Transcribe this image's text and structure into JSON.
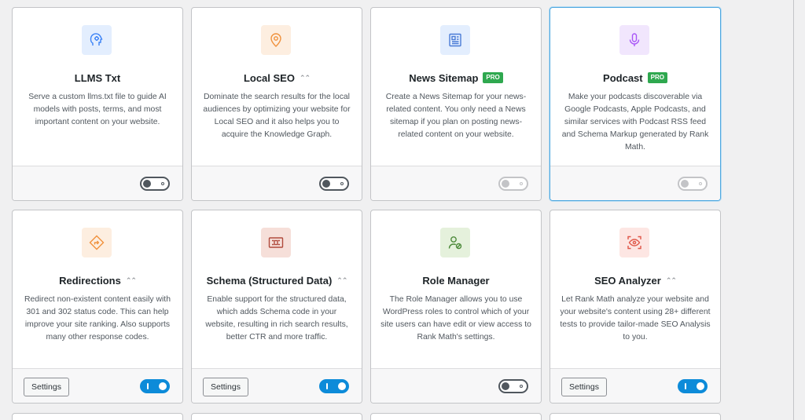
{
  "modules": [
    {
      "title": "LLMS Txt",
      "pro_badge": "",
      "has_chevron": false,
      "description": "Serve a custom llms.txt file to guide AI models with posts, terms, and most important content on your website.",
      "toggle_state": "off",
      "has_settings": false,
      "icon": "brain-head-icon",
      "icon_color": "#3b82f6",
      "icon_bg": "#e3eefe"
    },
    {
      "title": "Local SEO",
      "pro_badge": "",
      "has_chevron": true,
      "description": "Dominate the search results for the local audiences by optimizing your website for Local SEO and it also helps you to acquire the Knowledge Graph.",
      "toggle_state": "off",
      "has_settings": false,
      "icon": "location-pin-icon",
      "icon_color": "#f0913c",
      "icon_bg": "#fdeee0"
    },
    {
      "title": "News Sitemap",
      "pro_badge": "PRO",
      "has_chevron": false,
      "description": "Create a News Sitemap for your news-related content. You only need a News sitemap if you plan on posting news-related content on your website.",
      "toggle_state": "disabled",
      "has_settings": false,
      "icon": "newspaper-icon",
      "icon_color": "#4a7bd6",
      "icon_bg": "#e3eefe"
    },
    {
      "title": "Podcast",
      "pro_badge": "PRO",
      "has_chevron": false,
      "description": "Make your podcasts discoverable via Google Podcasts, Apple Podcasts, and similar services with Podcast RSS feed and Schema Markup generated by Rank Math.",
      "toggle_state": "disabled",
      "has_settings": false,
      "icon": "microphone-icon",
      "icon_color": "#a855f7",
      "icon_bg": "#f1e6fd"
    },
    {
      "title": "Redirections",
      "pro_badge": "",
      "has_chevron": true,
      "description": "Redirect non-existent content easily with 301 and 302 status code. This can help improve your site ranking. Also supports many other response codes.",
      "toggle_state": "on",
      "has_settings": true,
      "icon": "redirect-sign-icon",
      "icon_color": "#f0913c",
      "icon_bg": "#fdeee0"
    },
    {
      "title": "Schema (Structured Data)",
      "pro_badge": "",
      "has_chevron": true,
      "description": "Enable support for the structured data, which adds Schema code in your website, resulting in rich search results, better CTR and more traffic.",
      "toggle_state": "on",
      "has_settings": true,
      "icon": "schema-code-icon",
      "icon_color": "#b04a3c",
      "icon_bg": "#f6dfd9"
    },
    {
      "title": "Role Manager",
      "pro_badge": "",
      "has_chevron": false,
      "description": "The Role Manager allows you to use WordPress roles to control which of your site users can have edit or view access to Rank Math's settings.",
      "toggle_state": "off",
      "has_settings": false,
      "icon": "user-role-icon",
      "icon_color": "#4d8a3a",
      "icon_bg": "#e5f1dc"
    },
    {
      "title": "SEO Analyzer",
      "pro_badge": "",
      "has_chevron": true,
      "description": "Let Rank Math analyze your website and your website's content using 28+ different tests to provide tailor-made SEO Analysis to you.",
      "toggle_state": "on",
      "has_settings": true,
      "icon": "eye-scan-icon",
      "icon_color": "#e0584a",
      "icon_bg": "#fde6e3"
    }
  ],
  "settings_label": "Settings",
  "chevron_glyph": "⌃⌃",
  "highlight_index": 3
}
